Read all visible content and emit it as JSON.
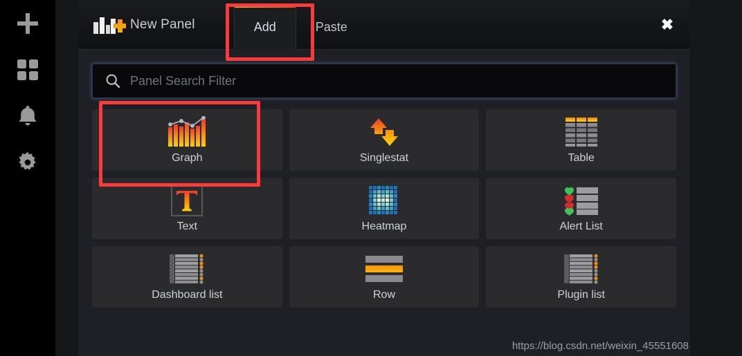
{
  "sidebar": {
    "items": [
      {
        "name": "create-add",
        "icon": "plus-icon"
      },
      {
        "name": "dashboards",
        "icon": "dashboards-grid-icon"
      },
      {
        "name": "alerting",
        "icon": "bell-icon"
      },
      {
        "name": "configuration",
        "icon": "gear-icon"
      }
    ]
  },
  "header": {
    "logo_icon": "bar-chart-plus-icon",
    "title": "New Panel",
    "close_label": "✖",
    "tabs": [
      {
        "label": "Add",
        "active": true
      },
      {
        "label": "Paste",
        "active": false
      }
    ]
  },
  "search": {
    "placeholder": "Panel Search Filter",
    "value": "",
    "icon": "search-icon"
  },
  "panels": [
    {
      "label": "Graph",
      "icon": "graph-icon"
    },
    {
      "label": "Singlestat",
      "icon": "singlestat-arrows-icon"
    },
    {
      "label": "Table",
      "icon": "table-grid-icon"
    },
    {
      "label": "Text",
      "icon": "text-t-icon"
    },
    {
      "label": "Heatmap",
      "icon": "heatmap-grid-icon"
    },
    {
      "label": "Alert List",
      "icon": "alert-list-hearts-icon"
    },
    {
      "label": "Dashboard list",
      "icon": "dashboard-list-icon"
    },
    {
      "label": "Row",
      "icon": "row-bars-icon"
    },
    {
      "label": "Plugin list",
      "icon": "plugin-list-icon"
    }
  ],
  "watermark": "https://blog.csdn.net/weixin_45551608",
  "colors": {
    "accent_start": "#f5d312",
    "accent_end": "#ed5c0b",
    "annotation": "#fb3b3b",
    "modal_bg": "#1f2025",
    "tile_bg": "#2b2b2e"
  }
}
